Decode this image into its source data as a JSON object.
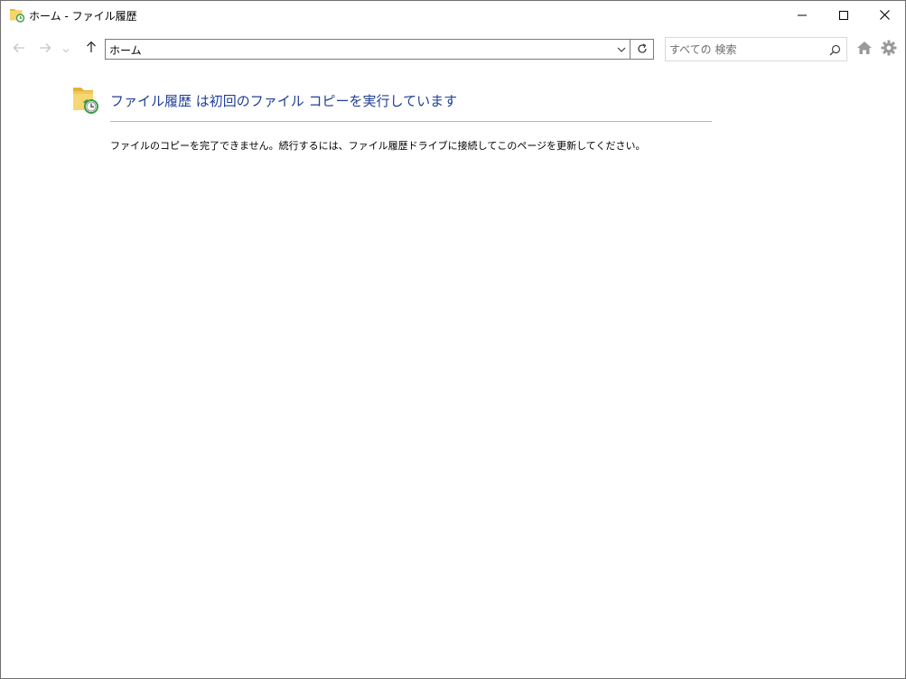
{
  "window": {
    "title": "ホーム - ファイル履歴"
  },
  "titlebar_buttons": {
    "minimize_icon": "minimize-icon",
    "maximize_icon": "maximize-icon",
    "close_icon": "close-icon"
  },
  "navigation": {
    "address": "ホーム",
    "search_placeholder": "すべての 検索",
    "back_icon": "arrow-left-icon",
    "forward_icon": "arrow-right-icon",
    "up_icon": "arrow-up-icon",
    "refresh_icon": "refresh-icon",
    "home_icon": "home-icon",
    "settings_icon": "gear-icon"
  },
  "content": {
    "heading": "ファイル履歴 は初回のファイル コピーを実行しています",
    "message": "ファイルのコピーを完了できません。続行するには、ファイル履歴ドライブに接続してこのページを更新してください。"
  },
  "colors": {
    "heading": "#1f3f95",
    "folder": "#f2c94c",
    "badge": "#3c9a45"
  }
}
